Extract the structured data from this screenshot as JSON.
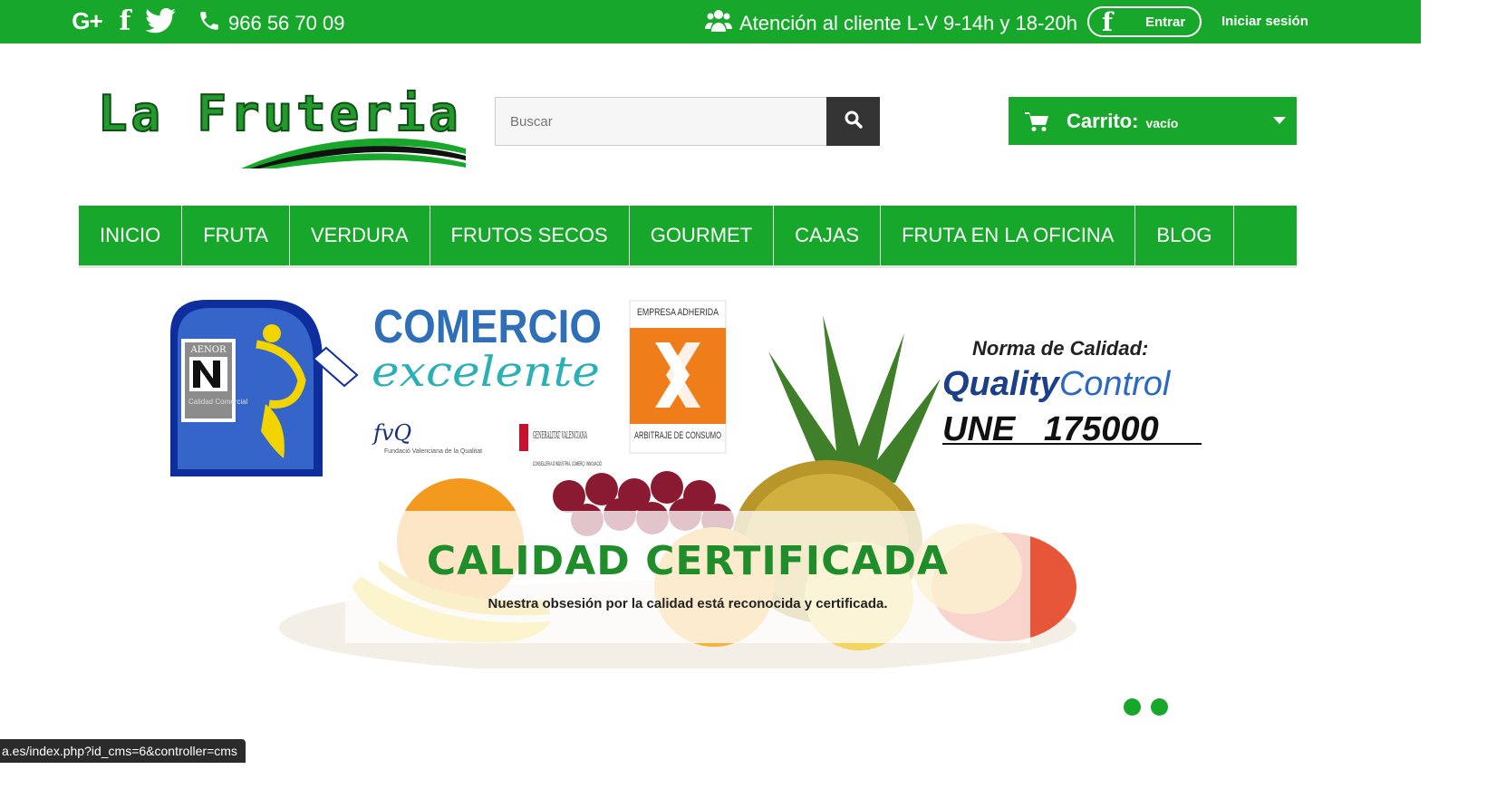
{
  "topbar": {
    "social_icons": [
      "google-plus-icon",
      "facebook-icon",
      "twitter-icon"
    ],
    "google_plus_glyph": "G+",
    "facebook_glyph": "f",
    "phone": "966 56 70 09",
    "support": "Atención al cliente L-V 9-14h y 18-20h",
    "facebook_login_label": "Entrar",
    "signin_label": "Iniciar sesión"
  },
  "header": {
    "logo_text": "La Fruteria",
    "search_placeholder": "Buscar",
    "cart_label": "Carrito:",
    "cart_value": "vacío"
  },
  "nav": {
    "items": [
      "INICIO",
      "FRUTA",
      "VERDURA",
      "FRUTOS SECOS",
      "GOURMET",
      "CAJAS",
      "FRUTA EN LA OFICINA",
      "BLOG"
    ]
  },
  "banner": {
    "aenor_label": "AENOR",
    "aenor_caption": "Calidad Comercial",
    "comercio_line1": "COMERCIO",
    "comercio_line2": "excelente",
    "fvq_label": "fvQ",
    "fvq_caption": "Fundació Valenciana de la Qualitat",
    "generalitat": "GENERALITAT VALENCIANA",
    "conselleria": "CONSELLERIA D'INDÚSTRIA, COMERÇ I INNOVACIÓ",
    "empresa_top": "EMPRESA ADHERIDA",
    "empresa_bottom": "ARBITRAJE DE CONSUMO",
    "norma_label": "Norma de Calidad:",
    "quality_bold": "Quality",
    "quality_light": "Control",
    "une_code": "UNE   175000",
    "headline": "CALIDAD CERTIFICADA",
    "subtitle": "Nuestra obsesión por la calidad está reconocida y certificada."
  },
  "slider": {
    "dot_count": 2
  },
  "status_url": "a.es/index.php?id_cms=6&controller=cms",
  "colors": {
    "brand_green": "#17a72a",
    "dark": "#333333",
    "headline_green": "#1e8d2a"
  }
}
